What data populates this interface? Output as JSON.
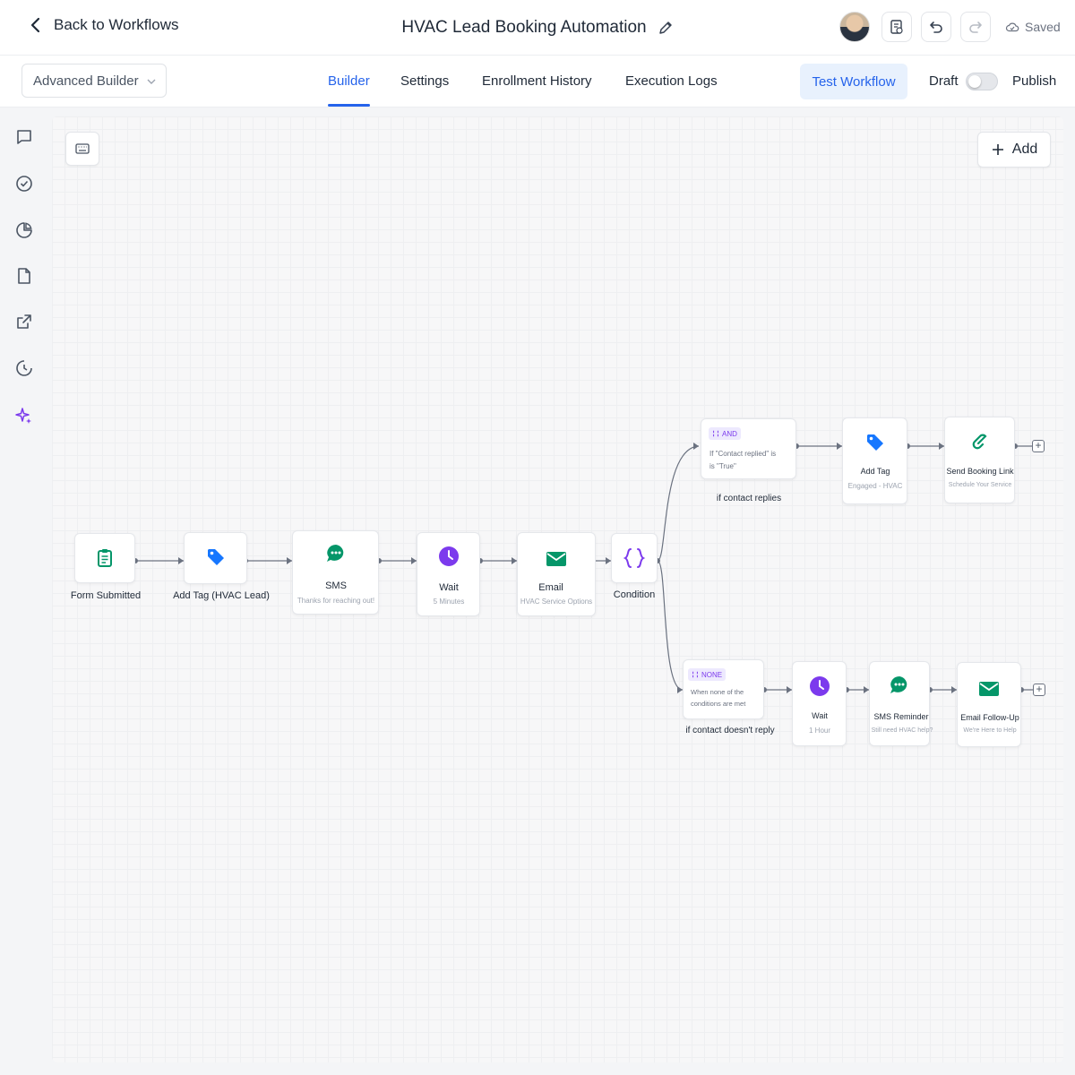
{
  "header": {
    "back_label": "Back to Workflows",
    "title": "HVAC Lead Booking Automation",
    "saved_label": "Saved"
  },
  "subbar": {
    "builder_mode": "Advanced Builder",
    "tabs": [
      "Builder",
      "Settings",
      "Enrollment History",
      "Execution Logs"
    ],
    "active_tab": "Builder",
    "test_label": "Test Workflow",
    "draft_label": "Draft",
    "publish_label": "Publish",
    "published": false
  },
  "canvas": {
    "add_label": "Add"
  },
  "main_flow": [
    {
      "icon": "clipboard-icon",
      "label": "Form Submitted",
      "sub": ""
    },
    {
      "icon": "tag-icon",
      "label": "Add Tag (HVAC Lead)",
      "sub": ""
    },
    {
      "icon": "chat-icon",
      "label": "SMS",
      "sub": "Thanks for reaching out!"
    },
    {
      "icon": "clock-icon",
      "label": "Wait",
      "sub": "5 Minutes"
    },
    {
      "icon": "mail-icon",
      "label": "Email",
      "sub": "HVAC Service Options"
    },
    {
      "icon": "braces-icon",
      "label": "Condition",
      "sub": ""
    }
  ],
  "branch_yes": {
    "badge": "AND",
    "condition_lines": [
      "If \"Contact replied\" is",
      "is \"True\""
    ],
    "caption": "if contact replies",
    "steps": [
      {
        "icon": "tag-icon",
        "label": "Add Tag",
        "sub": "Engaged - HVAC"
      },
      {
        "icon": "link-icon",
        "label": "Send Booking Link",
        "sub": "Schedule Your Service"
      }
    ]
  },
  "branch_no": {
    "badge": "NONE",
    "condition_lines": [
      "When none of the",
      "conditions are met"
    ],
    "caption": "if contact doesn't reply",
    "steps": [
      {
        "icon": "clock-icon",
        "label": "Wait",
        "sub": "1 Hour"
      },
      {
        "icon": "chat-icon",
        "label": "SMS Reminder",
        "sub": "Still need HVAC help?"
      },
      {
        "icon": "mail-icon",
        "label": "Email Follow-Up",
        "sub": "We're Here to Help"
      }
    ]
  },
  "colors": {
    "accent": "#2563eb",
    "green": "#059669",
    "blue_tag": "#1677ff",
    "purple": "#7c3aed"
  }
}
